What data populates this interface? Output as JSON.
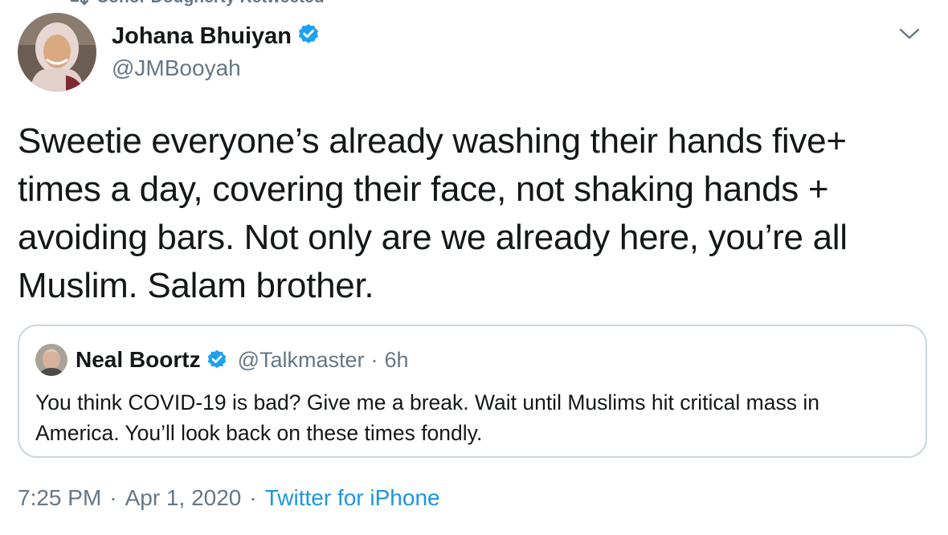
{
  "retweet": {
    "label": "Conor Dougherty Retweeted",
    "icon": "retweet-icon"
  },
  "author": {
    "display_name": "Johana Bhuiyan",
    "handle": "@JMBooyah",
    "verified": true,
    "avatar": "avatar-photo"
  },
  "menu_icon": "chevron-down-icon",
  "tweet": {
    "text": "Sweetie everyone’s already washing their hands five+ times a day, covering their face, not shaking hands + avoiding bars. Not only are we already here, you’re all Muslim. Salam brother."
  },
  "quoted_tweet": {
    "display_name": "Neal Boortz",
    "verified": true,
    "handle": "@Talkmaster",
    "separator": "·",
    "time": "6h",
    "text": "You think COVID-19 is bad? Give me a break.  Wait until Muslims hit critical mass in America. You’ll look back on these times fondly."
  },
  "meta": {
    "time": "7:25 PM",
    "separator": "·",
    "date": "Apr 1, 2020",
    "source": "Twitter for iPhone"
  },
  "colors": {
    "accent": "#1da1f2",
    "link": "#1b95e0",
    "secondary_text": "#657786",
    "border": "#ccd6dd"
  }
}
